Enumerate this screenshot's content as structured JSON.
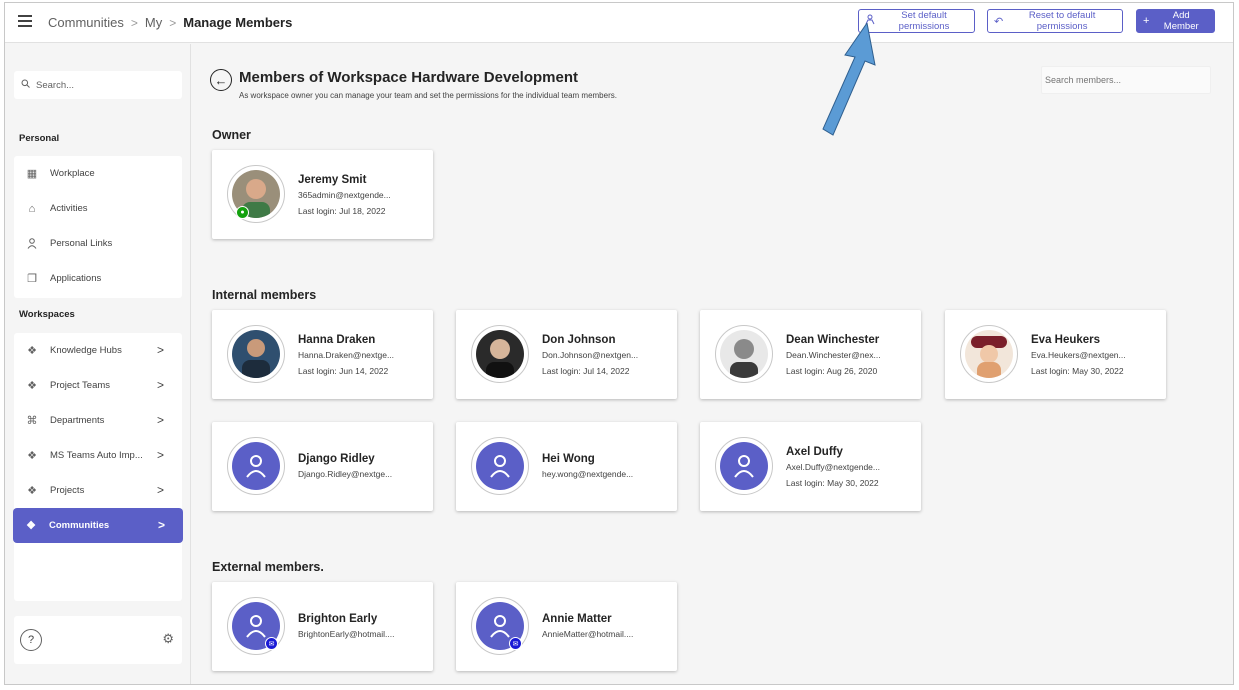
{
  "breadcrumb": [
    "Communities",
    "My",
    "Manage Members"
  ],
  "toolbar": {
    "set_default": "Set default permissions",
    "reset_default": "Reset to default permissions",
    "add_member": "Add Member"
  },
  "sidebar": {
    "search_placeholder": "Search...",
    "personal_heading": "Personal",
    "personal_items": [
      {
        "label": "Workplace",
        "icon": "grid-icon"
      },
      {
        "label": "Activities",
        "icon": "home-icon"
      },
      {
        "label": "Personal Links",
        "icon": "person-icon"
      },
      {
        "label": "Applications",
        "icon": "copy-icon"
      }
    ],
    "workspaces_heading": "Workspaces",
    "workspace_items": [
      {
        "label": "Knowledge Hubs",
        "icon": "teams-icon"
      },
      {
        "label": "Project Teams",
        "icon": "teams-icon"
      },
      {
        "label": "Departments",
        "icon": "org-icon"
      },
      {
        "label": "MS Teams Auto Imp...",
        "icon": "teams-icon"
      },
      {
        "label": "Projects",
        "icon": "projects-icon"
      },
      {
        "label": "Communities",
        "icon": "communities-icon"
      }
    ],
    "help": "?"
  },
  "main": {
    "title": "Members of Workspace Hardware Development",
    "subtitle": "As workspace owner you can manage your team and set the permissions for the individual team members.",
    "search_placeholder": "Search members...",
    "owner_heading": "Owner",
    "internal_heading": "Internal members",
    "external_heading": "External members."
  },
  "owner": {
    "name": "Jeremy Smit",
    "email": "365admin@nextgende...",
    "login": "Last login: Jul 18, 2022"
  },
  "internal": [
    {
      "name": "Hanna Draken",
      "email": "Hanna.Draken@nextge...",
      "login": "Last login: Jun 14, 2022"
    },
    {
      "name": "Don Johnson",
      "email": "Don.Johnson@nextgen...",
      "login": "Last login: Jul 14, 2022"
    },
    {
      "name": "Dean Winchester",
      "email": "Dean.Winchester@nex...",
      "login": "Last login: Aug 26, 2020"
    },
    {
      "name": "Eva Heukers",
      "email": "Eva.Heukers@nextgen...",
      "login": "Last login: May 30, 2022"
    },
    {
      "name": "Django Ridley",
      "email": "Django.Ridley@nextge..."
    },
    {
      "name": "Hei Wong",
      "email": "hey.wong@nextgende..."
    },
    {
      "name": "Axel Duffy",
      "email": "Axel.Duffy@nextgende...",
      "login": "Last login: May 30, 2022"
    }
  ],
  "external": [
    {
      "name": "Brighton Early",
      "email": "BrightonEarly@hotmail...."
    },
    {
      "name": "Annie Matter",
      "email": "AnnieMatter@hotmail...."
    }
  ],
  "colors": {
    "accent": "#5b5fc7",
    "owner_badge": "#13a10e",
    "mail_badge": "#1a1ad6",
    "callout_arrow": "#5b9bd5"
  }
}
